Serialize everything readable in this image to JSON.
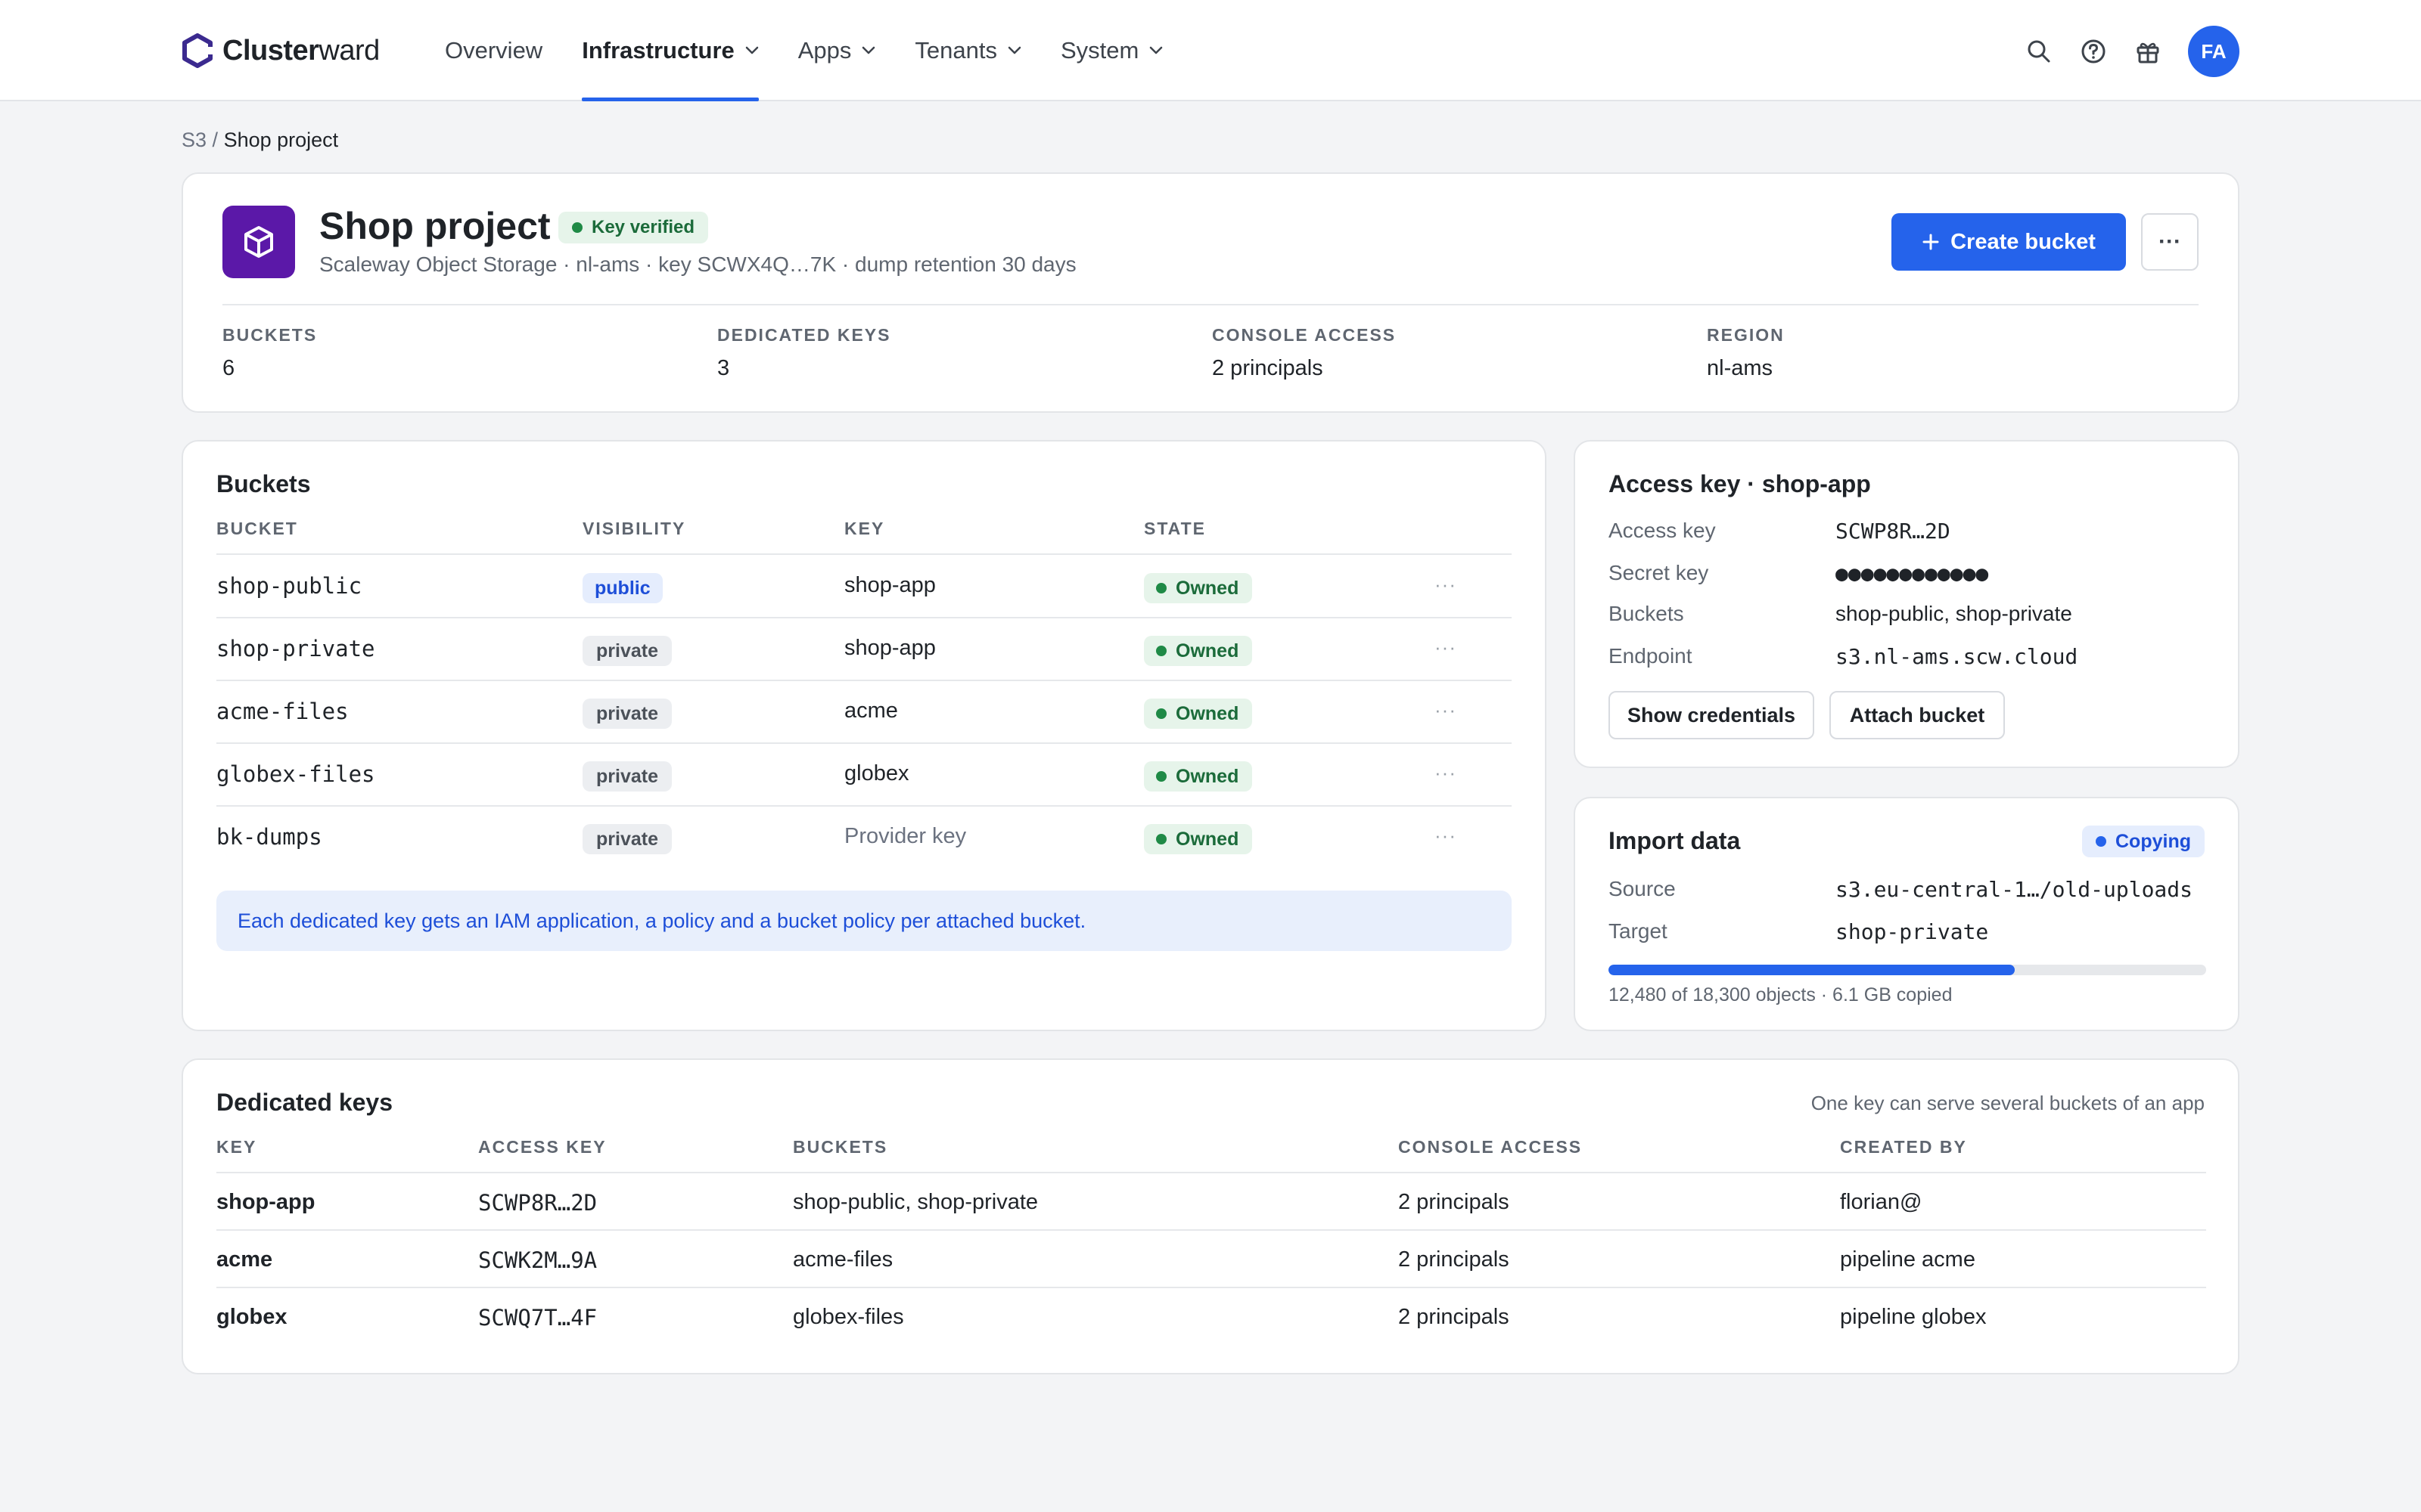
{
  "app": {
    "name_bold": "Cluster",
    "name_rest": "ward"
  },
  "nav": {
    "items": [
      {
        "label": "Overview"
      },
      {
        "label": "Infrastructure"
      },
      {
        "label": "Apps"
      },
      {
        "label": "Tenants"
      },
      {
        "label": "System"
      }
    ],
    "avatar_initials": "FA"
  },
  "breadcrumb": {
    "parent": "S3",
    "separator": "/",
    "current": "Shop project"
  },
  "project": {
    "title": "Shop project",
    "badge": "Key verified",
    "subtitle": "Scaleway Object Storage · nl-ams · key SCWX4Q…7K · dump retention 30 days",
    "create_button": "Create bucket",
    "more_button": "···",
    "stats": [
      {
        "label": "BUCKETS",
        "value": "6"
      },
      {
        "label": "DEDICATED KEYS",
        "value": "3"
      },
      {
        "label": "CONSOLE ACCESS",
        "value": "2 principals"
      },
      {
        "label": "REGION",
        "value": "nl-ams"
      }
    ]
  },
  "buckets": {
    "title": "Buckets",
    "columns": [
      "BUCKET",
      "VISIBILITY",
      "KEY",
      "STATE"
    ],
    "rows": [
      {
        "bucket": "shop-public",
        "visibility": "public",
        "key": "shop-app",
        "state": "Owned",
        "menu": "···"
      },
      {
        "bucket": "shop-private",
        "visibility": "private",
        "key": "shop-app",
        "state": "Owned",
        "menu": "···"
      },
      {
        "bucket": "acme-files",
        "visibility": "private",
        "key": "acme",
        "state": "Owned",
        "menu": "···"
      },
      {
        "bucket": "globex-files",
        "visibility": "private",
        "key": "globex",
        "state": "Owned",
        "menu": "···"
      },
      {
        "bucket": "bk-dumps",
        "visibility": "private",
        "key": "Provider key",
        "state": "Owned",
        "menu": "···"
      }
    ],
    "note": "Each dedicated key gets an IAM application, a policy and a bucket policy per attached bucket."
  },
  "access_key": {
    "title": "Access key · shop-app",
    "fields": [
      {
        "label": "Access key",
        "value": "SCWP8R…2D"
      },
      {
        "label": "Secret key",
        "value": "●●●●●●●●●●●●"
      },
      {
        "label": "Buckets",
        "value": "shop-public, shop-private"
      },
      {
        "label": "Endpoint",
        "value": "s3.nl-ams.scw.cloud"
      }
    ],
    "show_button": "Show credentials",
    "attach_button": "Attach bucket"
  },
  "import": {
    "title": "Import data",
    "status": "Copying",
    "source_label": "Source",
    "source_value": "s3.eu-central-1…/old-uploads",
    "target_label": "Target",
    "target_value": "shop-private",
    "progress_fraction": 0.68,
    "progress_text": "12,480 of 18,300 objects · 6.1 GB copied"
  },
  "keys": {
    "title": "Dedicated keys",
    "hint": "One key can serve several buckets of an app",
    "columns": [
      "KEY",
      "ACCESS KEY",
      "BUCKETS",
      "CONSOLE ACCESS",
      "CREATED BY"
    ],
    "rows": [
      {
        "key": "shop-app",
        "access_key": "SCWP8R…2D",
        "buckets": "shop-public, shop-private",
        "console": "2 principals",
        "created_by": "florian@"
      },
      {
        "key": "acme",
        "access_key": "SCWK2M…9A",
        "buckets": "acme-files",
        "console": "2 principals",
        "created_by": "pipeline acme"
      },
      {
        "key": "globex",
        "access_key": "SCWQ7T…4F",
        "buckets": "globex-files",
        "console": "2 principals",
        "created_by": "pipeline globex"
      }
    ]
  },
  "colors": {
    "accent": "#2563eb",
    "project_icon_bg": "#5b18a8",
    "success": "#1f8a46"
  }
}
